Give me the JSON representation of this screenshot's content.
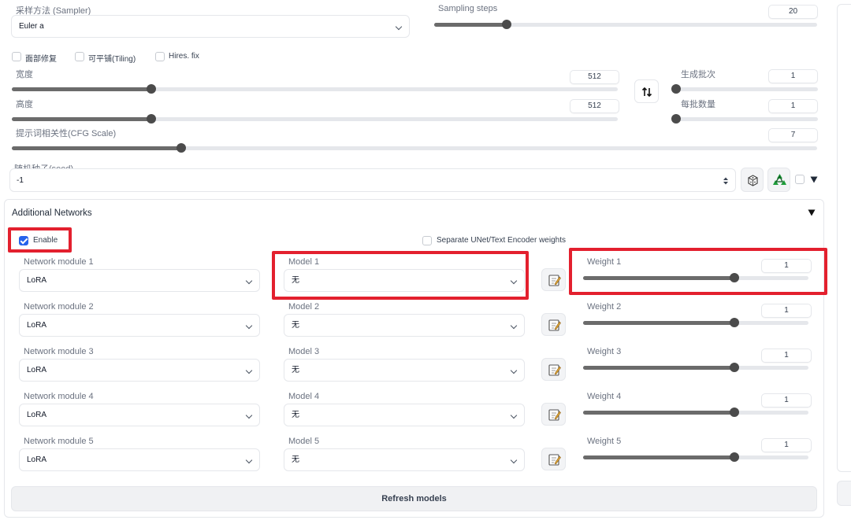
{
  "sampler": {
    "label": "采样方法 (Sampler)",
    "value": "Euler a"
  },
  "steps": {
    "label": "Sampling steps",
    "value": "20",
    "fraction": 0.19
  },
  "options": {
    "face": "面部修复",
    "tiling": "可平铺(Tiling)",
    "hires": "Hires. fix"
  },
  "width": {
    "label": "宽度",
    "value": "512",
    "fraction": 0.23
  },
  "height": {
    "label": "高度",
    "value": "512",
    "fraction": 0.23
  },
  "batch_count": {
    "label": "生成批次",
    "value": "1",
    "fraction": 0.0
  },
  "batch_size": {
    "label": "每批数量",
    "value": "1",
    "fraction": 0.0
  },
  "cfg": {
    "label": "提示词相关性(CFG Scale)",
    "value": "7",
    "fraction": 0.21
  },
  "seed": {
    "label": "随机种子(seed)",
    "value": "-1"
  },
  "additional": {
    "title": "Additional Networks",
    "enable": "Enable",
    "separate": "Separate UNet/Text Encoder weights",
    "rows": [
      {
        "module_label": "Network module 1",
        "module": "LoRA",
        "model_label": "Model 1",
        "model": "无",
        "weight_label": "Weight 1",
        "weight": "1",
        "fraction": 0.67
      },
      {
        "module_label": "Network module 2",
        "module": "LoRA",
        "model_label": "Model 2",
        "model": "无",
        "weight_label": "Weight 2",
        "weight": "1",
        "fraction": 0.67
      },
      {
        "module_label": "Network module 3",
        "module": "LoRA",
        "model_label": "Model 3",
        "model": "无",
        "weight_label": "Weight 3",
        "weight": "1",
        "fraction": 0.67
      },
      {
        "module_label": "Network module 4",
        "module": "LoRA",
        "model_label": "Model 4",
        "model": "无",
        "weight_label": "Weight 4",
        "weight": "1",
        "fraction": 0.67
      },
      {
        "module_label": "Network module 5",
        "module": "LoRA",
        "model_label": "Model 5",
        "model": "无",
        "weight_label": "Weight 5",
        "weight": "1",
        "fraction": 0.67
      }
    ],
    "refresh": "Refresh models"
  },
  "icons": {
    "swap": "swap-icon",
    "dice": "dice-icon",
    "recycle": "recycle-icon",
    "expand": "triangle-down-icon",
    "edit": "edit-icon"
  },
  "colors": {
    "highlight": "#e3202e",
    "accent": "#2563eb",
    "slider": "#6b6b6b"
  }
}
